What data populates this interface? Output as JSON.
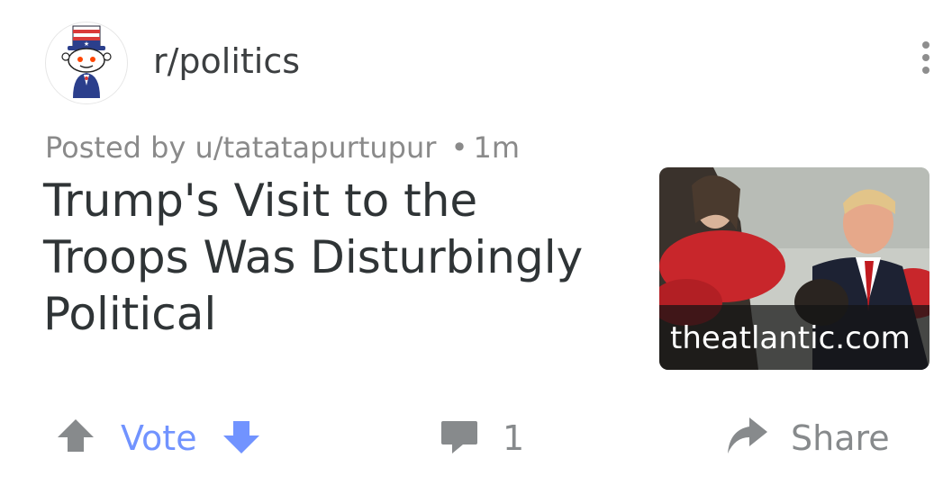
{
  "subreddit": {
    "name": "r/politics",
    "avatar_icon": "uncle-sam-snoo-icon"
  },
  "post": {
    "posted_by_prefix": "Posted by",
    "author": "u/tatatapurtupur",
    "separator": "•",
    "age": "1m",
    "title": "Trump's Visit to the Troops Was Disturbingly Political",
    "thumbnail": {
      "domain": "theatlantic.com"
    }
  },
  "actions": {
    "vote_label": "Vote",
    "comment_count": "1",
    "share_label": "Share",
    "vote_color": "#7193ff",
    "muted_color": "#878a8c"
  },
  "menu_icon": "overflow-menu-icon"
}
